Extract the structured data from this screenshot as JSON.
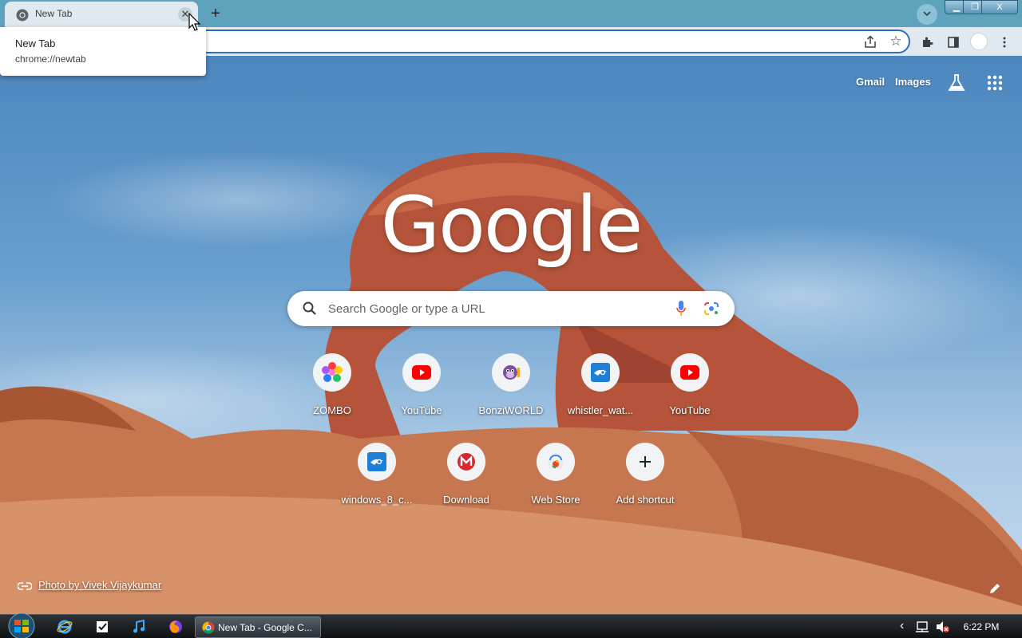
{
  "browser": {
    "tab": {
      "title": "New Tab",
      "close_glyph": "✕"
    },
    "new_tab_glyph": "+",
    "window_controls": {
      "minimize": "▁",
      "maximize": "❐",
      "close": "X"
    }
  },
  "hover_card": {
    "title": "New Tab",
    "url": "chrome://newtab"
  },
  "ntp": {
    "top_links": {
      "gmail": "Gmail",
      "images": "Images"
    },
    "logo": "Google",
    "search": {
      "placeholder": "Search Google or type a URL"
    },
    "shortcuts": [
      {
        "label": "ZOMBO",
        "icon": "zombo-flower-icon"
      },
      {
        "label": "YouTube",
        "icon": "youtube-icon"
      },
      {
        "label": "BonziWORLD",
        "icon": "bonzi-icon"
      },
      {
        "label": "whistler_wat...",
        "icon": "site-icon"
      },
      {
        "label": "YouTube",
        "icon": "youtube-icon"
      },
      {
        "label": "windows_8_c...",
        "icon": "site-icon"
      },
      {
        "label": "Download",
        "icon": "mega-icon"
      },
      {
        "label": "Web Store",
        "icon": "webstore-icon"
      },
      {
        "label": "Add shortcut",
        "icon": "plus-icon"
      }
    ],
    "photo_credit": "Photo by Vivek Vijaykumar"
  },
  "taskbar": {
    "task_label": "New Tab - Google C...",
    "tray_arrow": "‹",
    "clock": "6:22 PM"
  },
  "colors": {
    "tab_strip": "#5fa2bd",
    "toolbar": "#dfe9ef",
    "omnibox_border": "#2f6fbb",
    "youtube_red": "#ff0000"
  }
}
